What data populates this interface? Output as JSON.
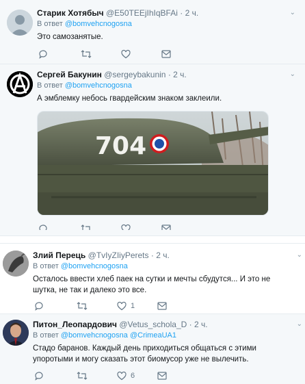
{
  "tweets": [
    {
      "name": "Старик Хотябыч",
      "handle": "@E50TEEjIhIqBFAi",
      "time": "2 ч.",
      "reply_label": "В ответ",
      "mentions": [
        "@bomvehcnogosna"
      ],
      "text": "Это самозанятые.",
      "reply_count": "",
      "retweet_count": "",
      "like_count": ""
    },
    {
      "name": "Сергей Бакунин",
      "handle": "@sergeybakunin",
      "time": "2 ч.",
      "reply_label": "В ответ",
      "mentions": [
        "@bomvehcnogosna"
      ],
      "text": "А эмблемку небось гвардейским знаком заклеили.",
      "media_number": "704",
      "reply_count": "",
      "retweet_count": "",
      "like_count": ""
    },
    {
      "name": "Злий Перець",
      "handle": "@TvIyZIiyPerets",
      "time": "2 ч.",
      "reply_label": "В ответ",
      "mentions": [
        "@bomvehcnogosna"
      ],
      "text": "Осталось ввести хлеб  паек на сутки и мечты сбудутся... И это не шутка, не так и далеко это все.",
      "reply_count": "",
      "retweet_count": "",
      "like_count": "1"
    },
    {
      "name": "Питон_Леопардович",
      "handle": "@Vetus_schola_D",
      "time": "2 ч.",
      "reply_label": "В ответ",
      "mentions": [
        "@bomvehcnogosna",
        "@CrimeaUA1"
      ],
      "text": "Стадо баранов. Каждый день приходиться общаться с этими упоротыми и могу сказать этот биомусор уже не вылечить.",
      "reply_count": "",
      "retweet_count": "",
      "like_count": "6"
    }
  ],
  "dot": "·",
  "colors": {
    "link": "#1da1f2",
    "muted": "#657786",
    "highlight_bg": "#f5f8fa"
  }
}
